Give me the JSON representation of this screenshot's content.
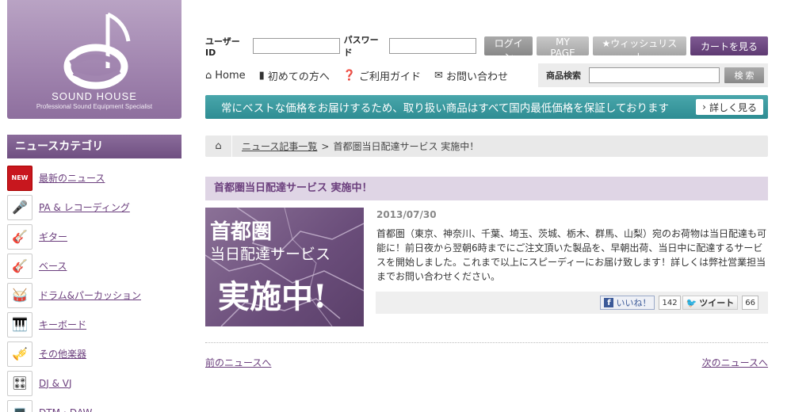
{
  "logo": {
    "name": "SOUND HOUSE",
    "tagline": "Professional Sound Equipment Specialist"
  },
  "sidebar": {
    "header": "ニュースカテゴリ",
    "items": [
      {
        "label": "最新のニュース",
        "badge": "NEW",
        "icon": "new-badge-icon"
      },
      {
        "label": "PA & レコーディング",
        "icon": "microphone-icon"
      },
      {
        "label": "ギター",
        "icon": "guitar-icon"
      },
      {
        "label": "ベース",
        "icon": "bass-icon"
      },
      {
        "label": "ドラム&パーカッション",
        "icon": "drum-icon"
      },
      {
        "label": "キーボード",
        "icon": "keyboard-icon"
      },
      {
        "label": "その他楽器",
        "icon": "harmonica-icon"
      },
      {
        "label": "DJ & VJ",
        "icon": "dj-controller-icon"
      },
      {
        "label": "DTM・DAW",
        "icon": "dtm-icon"
      }
    ]
  },
  "login": {
    "user_label": "ユーザーID",
    "password_label": "パスワード",
    "user_value": "",
    "password_value": "",
    "login_button": "ログイン",
    "mypage_button": "MY PAGE",
    "wishlist_button": "★ウィッシュリスト",
    "cart_button": "カートを見る"
  },
  "nav": {
    "home": "Home",
    "beginners": "初めての方へ",
    "guide": "ご利用ガイド",
    "contact": "お問い合わせ"
  },
  "search": {
    "label": "商品検索",
    "value": "",
    "button": "検 索"
  },
  "banner": {
    "text": "常にベストな価格をお届けするため、取り扱い商品はすべて国内最低価格を保証しております",
    "button": "詳しく見る"
  },
  "breadcrumb": {
    "link": "ニュース記事一覧",
    "separator": ">",
    "current": "首都圏当日配達サービス 実施中！"
  },
  "article": {
    "title": "首都圏当日配達サービス 実施中！",
    "image_text": {
      "line1": "首都圏",
      "line2": "当日配達サービス",
      "line3": "実施中!"
    },
    "date": "2013/07/30",
    "body": "首都圏（東京、神奈川、千葉、埼玉、茨城、栃木、群馬、山梨）宛のお荷物は当日配達も可能に！前日夜から翌朝6時までにご注文頂いた製品を、早朝出荷、当日中に配達するサービスを開始しました。これまで以上にスピーディーにお届け致します！詳しくは弊社営業担当までお問い合わせください。",
    "facebook_label": "いいね！",
    "facebook_count": "142",
    "twitter_label": "ツイート",
    "twitter_count": "66"
  },
  "pager": {
    "prev": "前のニュースへ",
    "next": "次のニュースへ"
  },
  "colors": {
    "brand_purple": "#6f4f81",
    "banner_teal": "#2e8d93",
    "title_bg": "#dfd5e5"
  }
}
